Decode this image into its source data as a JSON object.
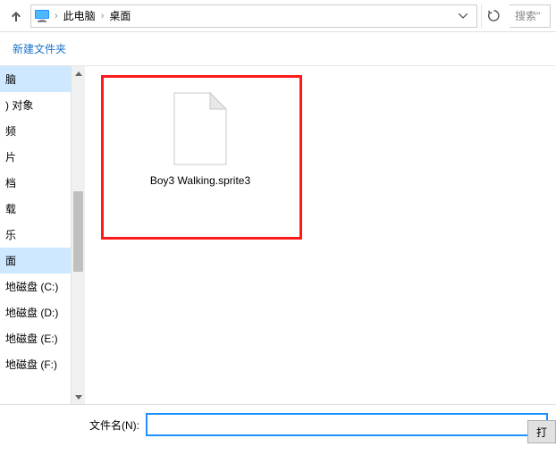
{
  "addressbar": {
    "path_parts": [
      "此电脑",
      "桌面"
    ],
    "separator": "›"
  },
  "search": {
    "placeholder": "搜索\""
  },
  "toolbar": {
    "new_folder": "新建文件夹"
  },
  "sidebar": {
    "items": [
      {
        "label": "脑",
        "selected": true
      },
      {
        "label": ") 对象"
      },
      {
        "label": "频"
      },
      {
        "label": "片"
      },
      {
        "label": "档"
      },
      {
        "label": "载"
      },
      {
        "label": "乐"
      },
      {
        "label": "面",
        "current": true
      },
      {
        "label": " 地磁盘 (C:)"
      },
      {
        "label": " 地磁盘 (D:)"
      },
      {
        "label": " 地磁盘 (E:)"
      },
      {
        "label": " 地磁盘 (F:)"
      }
    ]
  },
  "files": [
    {
      "name": "Boy3 Walking.sprite3"
    }
  ],
  "footer": {
    "filename_label": "文件名(N):",
    "filename_value": "",
    "open_label": "打"
  }
}
